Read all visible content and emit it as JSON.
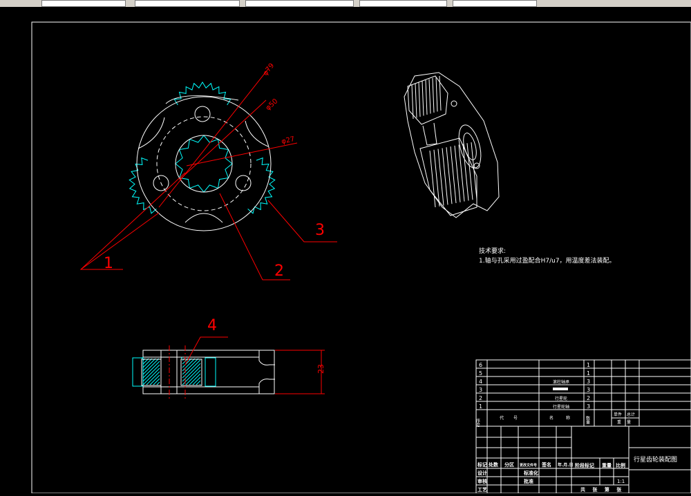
{
  "drawing": {
    "colors": {
      "background": "#000000",
      "frame": "#ffffff",
      "dimension": "#ff0000",
      "teeth": "#00ffff"
    },
    "dimensions": {
      "d79": "φ79",
      "d50": "φ50",
      "d27": "φ27",
      "h23": "23"
    },
    "balloons": {
      "b1": "1",
      "b2": "2",
      "b3": "3",
      "b4": "4"
    },
    "tech_requirements": {
      "title": "技术要求:",
      "line1": "1.轴与孔采用过盈配合H7/u7，用温度差法装配。"
    },
    "bom": {
      "rows": [
        {
          "no": "6",
          "name": "",
          "qty": "1"
        },
        {
          "no": "5",
          "name": "",
          "qty": "1"
        },
        {
          "no": "4",
          "name": "滚柱轴承",
          "qty": "3"
        },
        {
          "no": "3",
          "name": "",
          "qty": "3"
        },
        {
          "no": "2",
          "name": "行星轮",
          "qty": "2"
        },
        {
          "no": "1",
          "name": "行星轮轴",
          "qty": "3"
        }
      ],
      "header": {
        "seq": "序号",
        "code": "代号",
        "name": "名称",
        "qty": "数量",
        "unit": "单件",
        "total": "总计",
        "weight": "重量"
      }
    },
    "title_block": {
      "title": "行星齿轮装配图",
      "mark": "标记",
      "count": "处数",
      "zone": "分区",
      "docno": "更改文件号",
      "sign": "签名",
      "date": "年.月.日",
      "design": "设计",
      "std": "标准化",
      "review": "审核",
      "craft": "工艺",
      "approve": "批准",
      "stage": "阶段标记",
      "weight": "重量",
      "scale": "比例",
      "scale_val": "1:1",
      "sheets": "共 张 第 张"
    }
  }
}
